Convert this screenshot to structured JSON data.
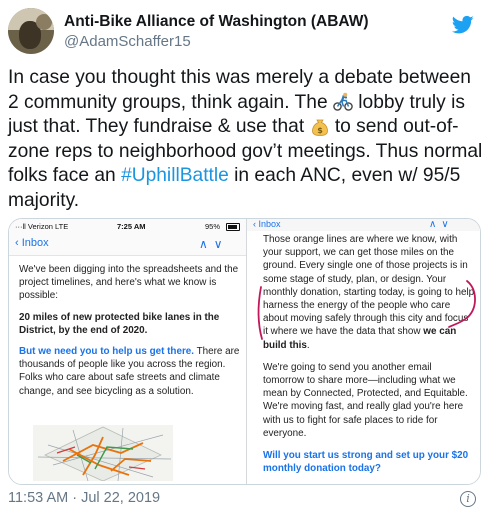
{
  "tweet": {
    "author_name": "Anti-Bike Alliance of Washington (ABAW)",
    "handle": "@AdamSchaffer15",
    "text_1": "In case you thought this was merely a debate between 2 community groups, think again. The ",
    "emoji_1": "bicyclist-emoji",
    "text_2": " lobby truly is just that. They fundraise & use that ",
    "emoji_2": "money-bag-emoji",
    "text_3": " to send out-of-zone reps to neighborhood gov’t meetings. Thus normal folks face an ",
    "hashtag": "#UphillBattle",
    "text_4": " in each ANC, even w/ 95/5 majority.",
    "timestamp": "11:53 AM · Jul 22, 2019",
    "brand_icon": "twitter-bird-icon",
    "info_icon": "info-icon"
  },
  "left_screenshot": {
    "carrier": "···ll Verizon  LTE",
    "time": "7:25 AM",
    "battery": "95%",
    "inbox_label": "Inbox",
    "p1": "We've been digging into the spreadsheets and the project timelines, and here's what we know is possible:",
    "p2_bold": "20 miles of new protected bike lanes in the District, by the end of 2020.",
    "p3_blue": "But we need you to help us get there.",
    "p3_rest": " There are thousands of people like you across the region. Folks who care about safe streets and climate change, and see bicycling as a solution."
  },
  "right_screenshot": {
    "inbox_label": "Inbox",
    "p1": "Those orange lines are where we know, with your support, we can get those miles on the ground. Every single one of those projects is in some stage of study, plan, or design. Your monthly donation, starting today, is going to help harness the energy of the people who care about moving safely through this city and focus it where we have the data that show ",
    "p1_bold": "we can build this",
    "p1_end": ".",
    "p2": "We're going to send you another email tomorrow to share more—including what we mean by Connected, Protected, and Equitable. We're moving fast, and really glad you're here with us to fight for safe places to ride for everyone.",
    "p3_blue": "Will you start us strong and set up your $20 monthly donation today?"
  },
  "colors": {
    "twitter_blue": "#1da1f2",
    "hashtag_blue": "#1b95e0",
    "email_link_blue": "#1a73e8",
    "annotation_magenta": "#c2185b",
    "map_orange": "#e8730c"
  }
}
